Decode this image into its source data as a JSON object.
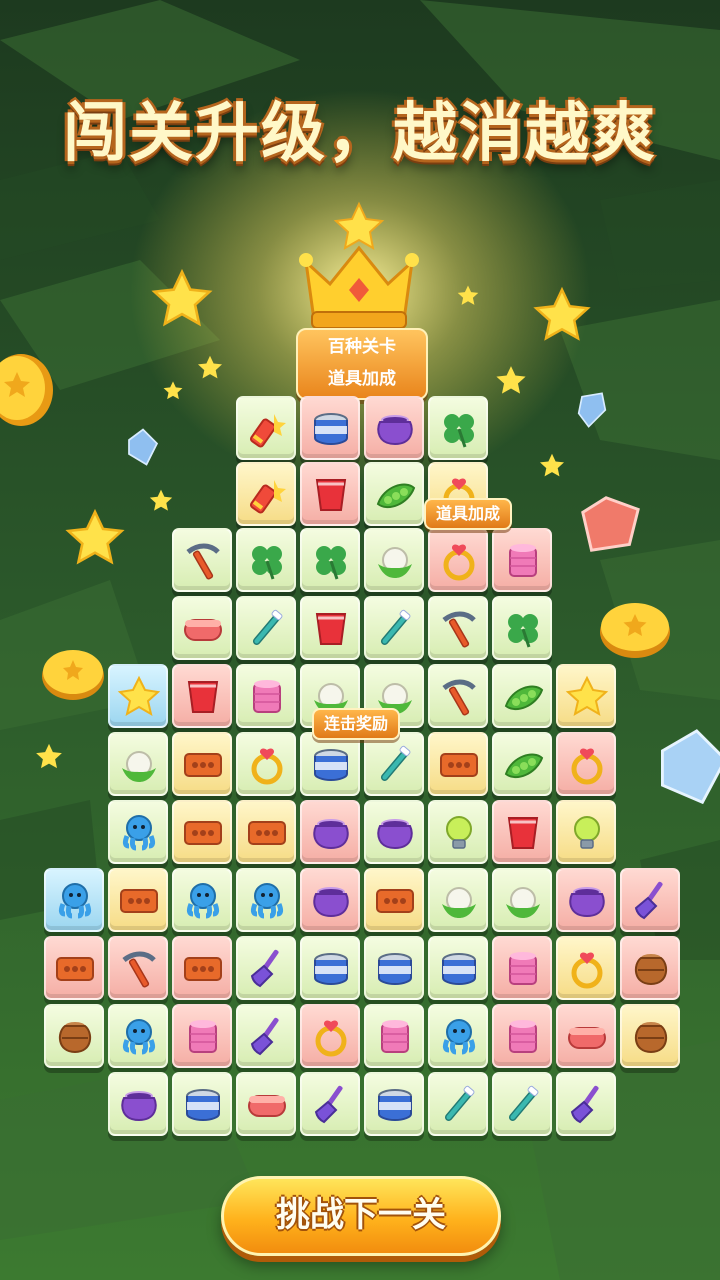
{
  "header": {
    "title": "闯关升级，越消越爽"
  },
  "labels": {
    "plaque_line1": "百种关卡",
    "plaque_line2": "道具加成",
    "booster_tag": "道具加成",
    "combo_tag": "连击奖励"
  },
  "action": {
    "next_level_button": "挑战下一关"
  },
  "colors": {
    "accent": "#f5a21e",
    "board_bg": "#2f5a2a"
  },
  "board": {
    "rows": [
      [
        [
          "firework",
          "green"
        ],
        [
          "can",
          "pink"
        ],
        [
          "pot",
          "pink"
        ],
        [
          "clover",
          "green"
        ]
      ],
      [
        [
          "firework",
          "yellow"
        ],
        [
          "cup",
          "pink"
        ],
        [
          "peas",
          "green"
        ],
        [
          "ring",
          "yellow"
        ]
      ],
      [
        [
          "pickaxe",
          "green"
        ],
        [
          "clover",
          "green"
        ],
        [
          "clover",
          "green"
        ],
        [
          "cauliflower",
          "green"
        ],
        [
          "ring",
          "pink"
        ],
        [
          "thread",
          "pink"
        ]
      ],
      [
        [
          "sponge",
          "green"
        ],
        [
          "toothbrush",
          "green"
        ],
        [
          "cup",
          "green"
        ],
        [
          "toothbrush",
          "green"
        ],
        [
          "pickaxe",
          "green"
        ],
        [
          "clover",
          "green"
        ]
      ],
      [
        [
          "star",
          "blue"
        ],
        [
          "cup",
          "pink"
        ],
        [
          "thread",
          "green"
        ],
        [
          "cauliflower",
          "green"
        ],
        [
          "cauliflower",
          "green"
        ],
        [
          "pickaxe",
          "green"
        ],
        [
          "peas",
          "green"
        ],
        [
          "star",
          "yellow"
        ]
      ],
      [
        [
          "cauliflower",
          "green"
        ],
        [
          "brick",
          "yellow"
        ],
        [
          "ring",
          "green"
        ],
        [
          "can",
          "green"
        ],
        [
          "toothbrush",
          "green"
        ],
        [
          "brick",
          "yellow"
        ],
        [
          "peas",
          "green"
        ],
        [
          "ring",
          "pink"
        ]
      ],
      [
        [
          "octopus",
          "green"
        ],
        [
          "brick",
          "yellow"
        ],
        [
          "brick",
          "yellow"
        ],
        [
          "pot",
          "pink"
        ],
        [
          "pot",
          "green"
        ],
        [
          "bulb",
          "green"
        ],
        [
          "cup",
          "pink"
        ],
        [
          "bulb",
          "yellow"
        ]
      ],
      [
        [
          "octopus",
          "blue"
        ],
        [
          "brick",
          "yellow"
        ],
        [
          "octopus",
          "green"
        ],
        [
          "octopus",
          "green"
        ],
        [
          "pot",
          "pink"
        ],
        [
          "brick",
          "yellow"
        ],
        [
          "cauliflower",
          "green"
        ],
        [
          "cauliflower",
          "green"
        ],
        [
          "pot",
          "pink"
        ],
        [
          "broom",
          "pink"
        ]
      ],
      [
        [
          "brick",
          "pink"
        ],
        [
          "pickaxe",
          "pink"
        ],
        [
          "brick",
          "pink"
        ],
        [
          "broom",
          "green"
        ],
        [
          "can",
          "green"
        ],
        [
          "can",
          "green"
        ],
        [
          "can",
          "green"
        ],
        [
          "thread",
          "pink"
        ],
        [
          "ring",
          "yellow"
        ],
        [
          "vase",
          "pink"
        ]
      ],
      [
        [
          "vase",
          "green"
        ],
        [
          "octopus",
          "green"
        ],
        [
          "thread",
          "pink"
        ],
        [
          "broom",
          "green"
        ],
        [
          "ring",
          "pink"
        ],
        [
          "thread",
          "green"
        ],
        [
          "octopus",
          "green"
        ],
        [
          "thread",
          "pink"
        ],
        [
          "sponge",
          "pink"
        ],
        [
          "vase",
          "yellow"
        ]
      ],
      [
        [
          "pot",
          "green"
        ],
        [
          "can",
          "green"
        ],
        [
          "sponge",
          "green"
        ],
        [
          "broom",
          "green"
        ],
        [
          "can",
          "green"
        ],
        [
          "toothbrush",
          "green"
        ],
        [
          "toothbrush",
          "green"
        ],
        [
          "broom",
          "green"
        ]
      ]
    ]
  }
}
